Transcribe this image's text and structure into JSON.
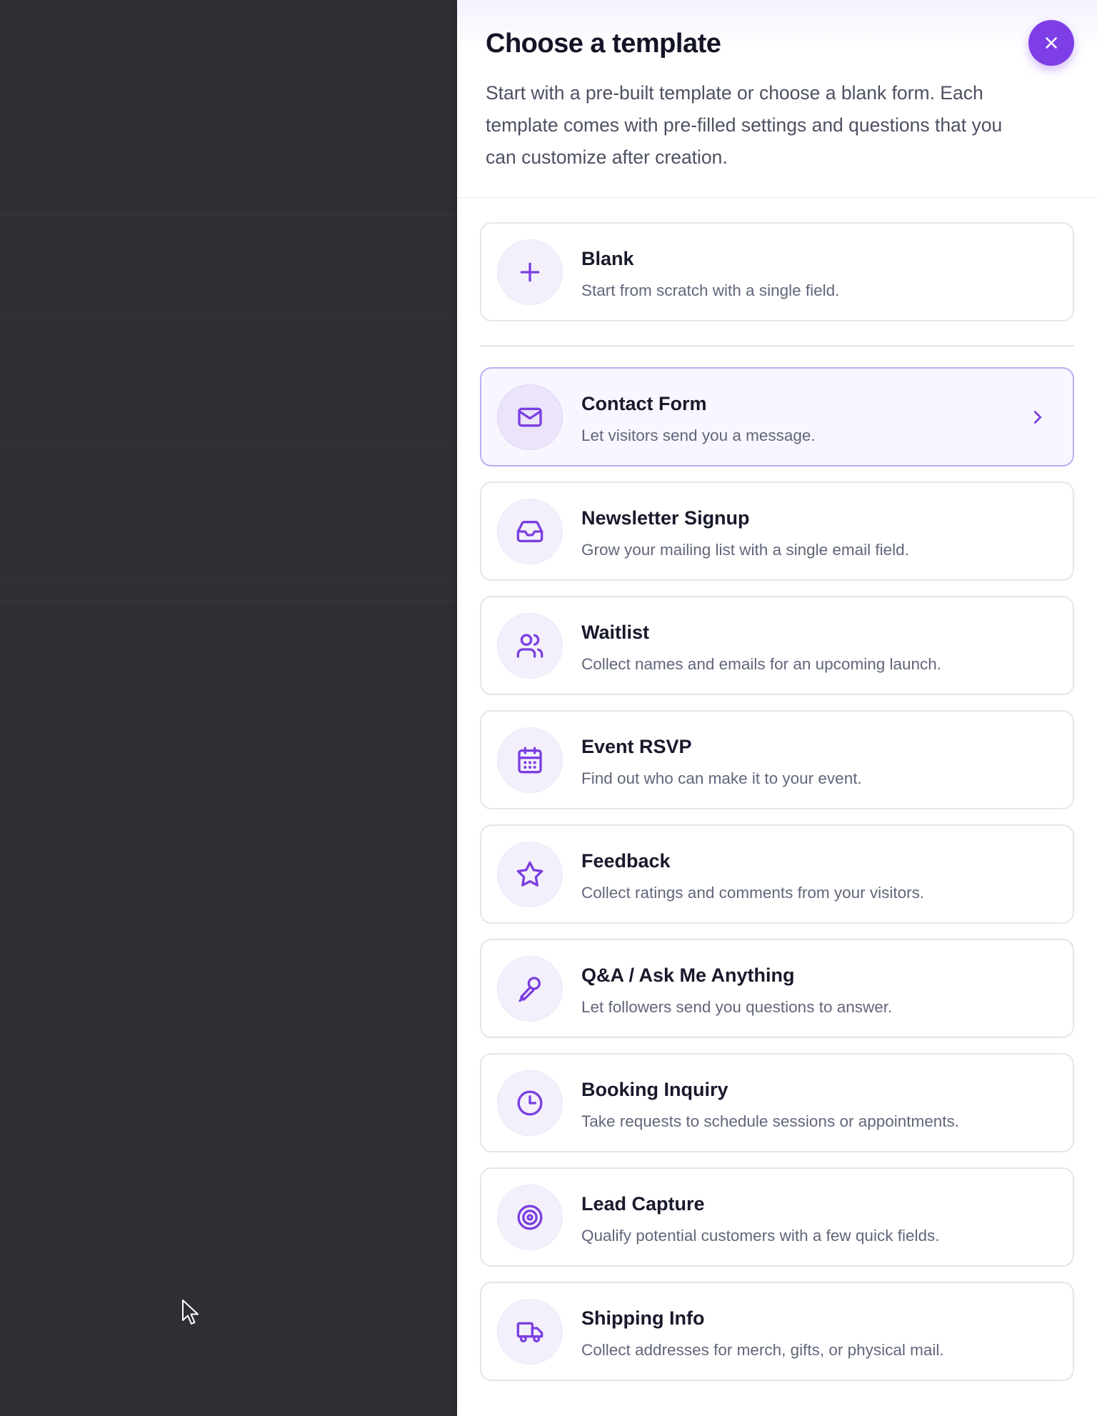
{
  "panel": {
    "title": "Choose a template",
    "description": "Start with a pre-built template or choose a blank form. Each template comes with pre-filled settings and questions that you can customize after creation."
  },
  "close_icon": "close-icon",
  "colors": {
    "accent": "#7d3ee6",
    "icon_stroke": "#7b3fe0",
    "selected_border": "#c0adf2",
    "selected_background": "#f8f6fe"
  },
  "blank": {
    "title": "Blank",
    "description": "Start from scratch with a single field.",
    "icon": "plus-icon"
  },
  "templates": [
    {
      "title": "Contact Form",
      "description": "Let visitors send you a message.",
      "icon": "mail-icon",
      "selected": true
    },
    {
      "title": "Newsletter Signup",
      "description": "Grow your mailing list with a single email field.",
      "icon": "inbox-icon"
    },
    {
      "title": "Waitlist",
      "description": "Collect names and emails for an upcoming launch.",
      "icon": "users-icon"
    },
    {
      "title": "Event RSVP",
      "description": "Find out who can make it to your event.",
      "icon": "calendar-icon"
    },
    {
      "title": "Feedback",
      "description": "Collect ratings and comments from your visitors.",
      "icon": "star-icon"
    },
    {
      "title": "Q&A / Ask Me Anything",
      "description": "Let followers send you questions to answer.",
      "icon": "microphone-icon"
    },
    {
      "title": "Booking Inquiry",
      "description": "Take requests to schedule sessions or appointments.",
      "icon": "clock-icon"
    },
    {
      "title": "Lead Capture",
      "description": "Qualify potential customers with a few quick fields.",
      "icon": "target-icon"
    },
    {
      "title": "Shipping Info",
      "description": "Collect addresses for merch, gifts, or physical mail.",
      "icon": "truck-icon"
    }
  ]
}
